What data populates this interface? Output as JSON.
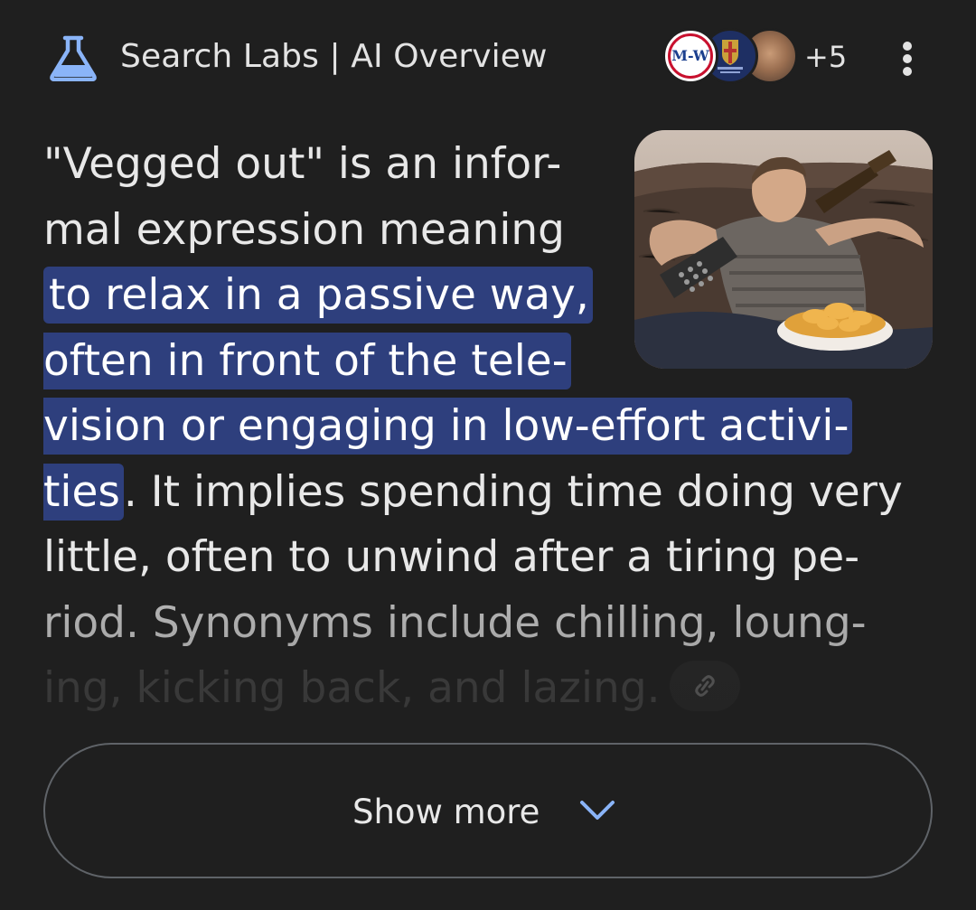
{
  "header": {
    "title": "Search Labs | AI Overview",
    "sources": {
      "first_source_label": "M-W",
      "more_count": "+5"
    },
    "icons": {
      "labs": "flask-icon",
      "menu": "more-vert-icon"
    }
  },
  "overview": {
    "lines": {
      "l1": "\"Vegged out\" is an infor-",
      "l2": "mal expression meaning",
      "l3": "to relax in a passive way,",
      "l4": "often in front of the tele-",
      "l5": "vision or engaging in low-effort activi-",
      "l6_hl": "ties",
      "l6_rest": ". It implies spending time doing very",
      "l7": "little, often to unwind after a tiring pe-",
      "l8": "riod. Synonyms include chilling, loung-",
      "l9": "ing, kicking back, and lazing."
    },
    "link_icon": "link-icon"
  },
  "show_more": {
    "label": "Show more",
    "icon": "chevron-down-icon"
  },
  "colors": {
    "background": "#1f1f1f",
    "highlight": "#2e3f7d",
    "accent_blue": "#8ab4f8",
    "outline": "#5f6368"
  }
}
